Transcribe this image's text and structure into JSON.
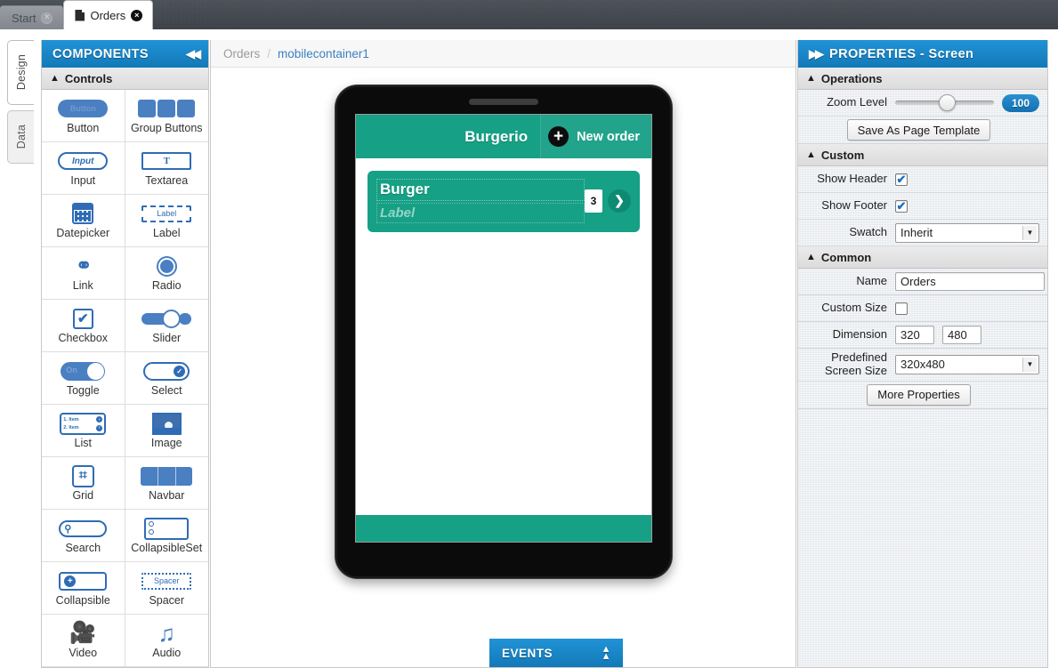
{
  "window": {
    "tabs": [
      {
        "label": "Start",
        "active": false,
        "close": "×",
        "has_doc_icon": false
      },
      {
        "label": "Orders",
        "active": true,
        "close": "×",
        "has_doc_icon": true
      }
    ]
  },
  "rail": {
    "items": [
      {
        "label": "Design",
        "active": true
      },
      {
        "label": "Data",
        "active": false
      }
    ]
  },
  "components": {
    "header_title": "COMPONENTS",
    "collapse_icon": "◀◀",
    "group_title": "Controls",
    "group_caret": "▲",
    "items": [
      {
        "label": "Button",
        "icon": "button-icon",
        "glyph": "Button"
      },
      {
        "label": "Group Buttons",
        "icon": "group-buttons-icon"
      },
      {
        "label": "Input",
        "icon": "input-icon",
        "glyph": "Input"
      },
      {
        "label": "Textarea",
        "icon": "textarea-icon",
        "glyph": "T"
      },
      {
        "label": "Datepicker",
        "icon": "datepicker-icon"
      },
      {
        "label": "Label",
        "icon": "label-icon",
        "glyph": "Label"
      },
      {
        "label": "Link",
        "icon": "link-icon",
        "glyph": "⚭"
      },
      {
        "label": "Radio",
        "icon": "radio-icon"
      },
      {
        "label": "Checkbox",
        "icon": "checkbox-icon",
        "glyph": "✔"
      },
      {
        "label": "Slider",
        "icon": "slider-icon"
      },
      {
        "label": "Toggle",
        "icon": "toggle-icon",
        "glyph": "On"
      },
      {
        "label": "Select",
        "icon": "select-icon",
        "glyph": "✓"
      },
      {
        "label": "List",
        "icon": "list-icon",
        "row1": "1. Item",
        "row2": "2. Item",
        "bullet": "›"
      },
      {
        "label": "Image",
        "icon": "image-icon"
      },
      {
        "label": "Grid",
        "icon": "grid-icon",
        "glyph": "⌗"
      },
      {
        "label": "Navbar",
        "icon": "navbar-icon"
      },
      {
        "label": "Search",
        "icon": "search-icon",
        "glyph": "⚲"
      },
      {
        "label": "CollapsibleSet",
        "icon": "collapsible-set-icon"
      },
      {
        "label": "Collapsible",
        "icon": "collapsible-icon",
        "glyph": "+"
      },
      {
        "label": "Spacer",
        "icon": "spacer-icon",
        "glyph": "Spacer"
      },
      {
        "label": "Video",
        "icon": "video-icon",
        "glyph": "🎥"
      },
      {
        "label": "Audio",
        "icon": "audio-icon",
        "glyph": "♫"
      }
    ]
  },
  "canvas": {
    "breadcrumb": {
      "root": "Orders",
      "separator": "/",
      "current": "mobilecontainer1"
    },
    "device": {
      "app_title": "Burgerio",
      "new_order_label": "New order",
      "plus_glyph": "+",
      "card": {
        "title": "Burger",
        "subtitle": "Label",
        "count": "3",
        "chevron": "❯"
      }
    },
    "events_bar": {
      "label": "EVENTS",
      "expand_icon": "▲"
    }
  },
  "properties": {
    "header_title": "PROPERTIES - Screen",
    "expand_icon": "▶▶",
    "sections": {
      "operations": {
        "title": "Operations",
        "caret": "▲"
      },
      "custom": {
        "title": "Custom",
        "caret": "▲"
      },
      "common": {
        "title": "Common",
        "caret": "▲"
      }
    },
    "zoom_level": {
      "label": "Zoom Level",
      "value": "100"
    },
    "save_template_button": "Save As Page Template",
    "show_header": {
      "label": "Show Header",
      "checked": true,
      "check_glyph": "✔"
    },
    "show_footer": {
      "label": "Show Footer",
      "checked": true,
      "check_glyph": "✔"
    },
    "swatch": {
      "label": "Swatch",
      "value": "Inherit",
      "arrow": "▼"
    },
    "name": {
      "label": "Name",
      "value": "Orders"
    },
    "custom_size": {
      "label": "Custom Size",
      "checked": false
    },
    "dimension": {
      "label": "Dimension",
      "width": "320",
      "height": "480"
    },
    "predefined_screen_size": {
      "label_line1": "Predefined",
      "label_line2": "Screen Size",
      "value": "320x480",
      "arrow": "▼"
    },
    "more_properties_button": "More Properties"
  },
  "colors": {
    "panel_blue": "#1a86c8",
    "app_green": "#16a085",
    "topbar_dark": "#444a52",
    "link_blue": "#3a7fc1",
    "component_blue": "#2f6cb5"
  }
}
